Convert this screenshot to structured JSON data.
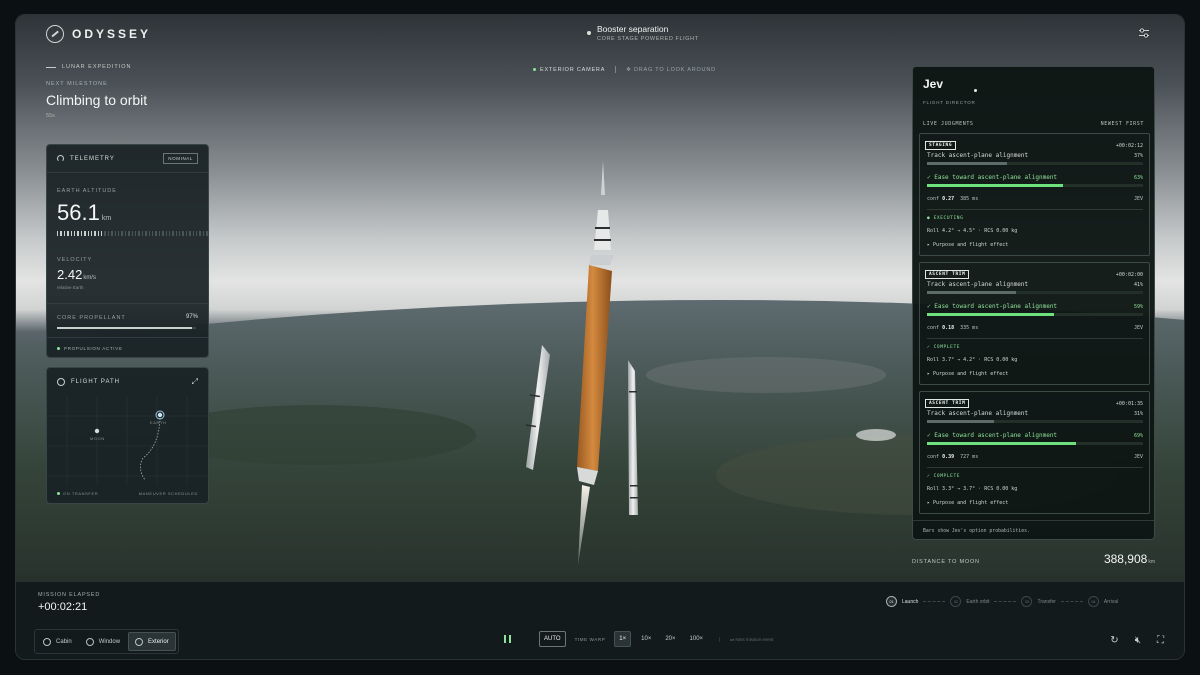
{
  "app": {
    "logo": "ODYSSEY"
  },
  "header": {
    "status_title": "Booster separation",
    "status_sub": "CORE STAGE POWERED FLIGHT",
    "settings_icon": "sliders-icon"
  },
  "mission": {
    "expedition": "LUNAR EXPEDITION",
    "next_label": "NEXT MILESTONE",
    "milestone": "Climbing to orbit",
    "eta": "55s"
  },
  "camera": {
    "label": "EXTERIOR CAMERA",
    "hint": "DRAG TO LOOK AROUND"
  },
  "telemetry": {
    "title": "TELEMETRY",
    "badge": "NOMINAL",
    "altitude_label": "EARTH ALTITUDE",
    "altitude_value": "56.1",
    "altitude_unit": "km",
    "altitude_fraction": 0.32,
    "velocity_label": "VELOCITY",
    "velocity_value": "2.42",
    "velocity_unit": "km/s",
    "velocity_sub": "relative Earth",
    "propellant_label": "CORE PROPELLANT",
    "propellant_pct": "97%",
    "propellant_fraction": 0.97,
    "status": "PROPULSION ACTIVE"
  },
  "flight_path": {
    "title": "FLIGHT PATH",
    "moon_label": "MOON",
    "earth_label": "EARTH",
    "footer_left": "ON TRANSFER",
    "footer_right": "MANEUVER SCHEDULED"
  },
  "director": {
    "name": "Jev",
    "role": "FLIGHT DIRECTOR",
    "section": "LIVE JUDGMENTS",
    "sort": "NEWEST FIRST",
    "footer": "Bars show Jev's option probabilities.",
    "cards": [
      {
        "tag": "STAGING",
        "time": "+00:02:12",
        "option1": "Track ascent-plane alignment",
        "p1": "37%",
        "f1": 0.37,
        "option2": "✓ Ease toward ascent-plane alignment",
        "p2": "63%",
        "f2": 0.63,
        "conf": "0.27",
        "latency": "385 ms",
        "who": "JEV",
        "state": "● EXECUTING",
        "roll": "Roll 4.2° → 4.5° · RCS 0.00 kg",
        "purpose": "▸ Purpose and flight effect"
      },
      {
        "tag": "ASCENT TRIM",
        "time": "+00:02:00",
        "option1": "Track ascent-plane alignment",
        "p1": "41%",
        "f1": 0.41,
        "option2": "✓ Ease toward ascent-plane alignment",
        "p2": "59%",
        "f2": 0.59,
        "conf": "0.18",
        "latency": "335 ms",
        "who": "JEV",
        "state": "✓ COMPLETE",
        "roll": "Roll 3.7° → 4.2° · RCS 0.00 kg",
        "purpose": "▸ Purpose and flight effect"
      },
      {
        "tag": "ASCENT TRIM",
        "time": "+00:01:35",
        "option1": "Track ascent-plane alignment",
        "p1": "31%",
        "f1": 0.31,
        "option2": "✓ Ease toward ascent-plane alignment",
        "p2": "69%",
        "f2": 0.69,
        "conf": "0.39",
        "latency": "727 ms",
        "who": "JEV",
        "state": "✓ COMPLETE",
        "roll": "Roll 3.3° → 3.7° · RCS 0.00 kg",
        "purpose": "▸ Purpose and flight effect"
      }
    ]
  },
  "distance": {
    "label": "DISTANCE TO MOON",
    "value": "388,908",
    "unit": "km"
  },
  "bottom": {
    "elapsed_label": "MISSION ELAPSED",
    "elapsed_value": "+00:02:21",
    "phases": [
      {
        "num": "01",
        "label": "Launch",
        "active": true
      },
      {
        "num": "02",
        "label": "Earth orbit",
        "active": false
      },
      {
        "num": "03",
        "label": "Transfer",
        "active": false
      },
      {
        "num": "04",
        "label": "Arrival",
        "active": false
      }
    ],
    "views": [
      "Cabin",
      "Window",
      "Exterior"
    ],
    "auto": "AUTO",
    "time_warp": "TIME WARP",
    "speeds": [
      "1×",
      "10×",
      "20×",
      "100×"
    ],
    "next_event": "Next mission event",
    "icons": [
      "restart-icon",
      "mute-icon",
      "fullscreen-icon"
    ]
  },
  "colors": {
    "accent": "#8fe39a",
    "rocket_core": "#c8782e"
  }
}
